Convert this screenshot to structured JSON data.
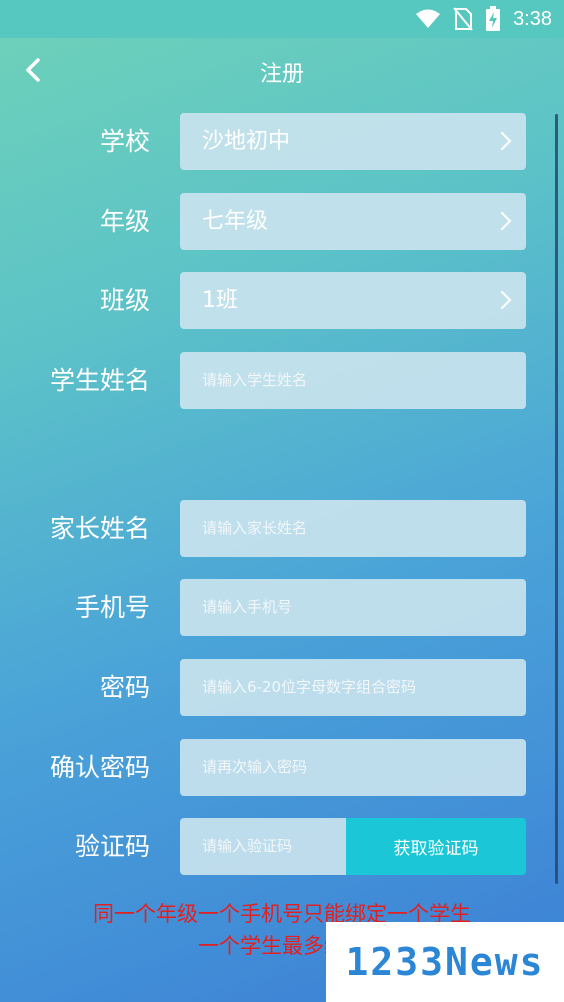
{
  "status_bar": {
    "time": "3:38"
  },
  "header": {
    "title": "注册"
  },
  "form": {
    "school": {
      "label": "学校",
      "value": "沙地初中"
    },
    "grade": {
      "label": "年级",
      "value": "七年级"
    },
    "class": {
      "label": "班级",
      "value": "1班"
    },
    "student_name": {
      "label": "学生姓名",
      "placeholder": "请输入学生姓名"
    },
    "parent_name": {
      "label": "家长姓名",
      "placeholder": "请输入家长姓名"
    },
    "phone": {
      "label": "手机号",
      "placeholder": "请输入手机号"
    },
    "password": {
      "label": "密码",
      "placeholder": "请输入6-20位字母数字组合密码"
    },
    "confirm_password": {
      "label": "确认密码",
      "placeholder": "请再次输入密码"
    },
    "verification_code": {
      "label": "验证码",
      "placeholder": "请输入验证码",
      "button": "获取验证码"
    }
  },
  "notice": {
    "line1": "同一个年级一个手机号只能绑定一个学生",
    "line2": "一个学生最多绑定"
  },
  "watermark": {
    "text": "1233News"
  },
  "colors": {
    "accent_button": "#1bc7d6",
    "notice_text": "#e3201f"
  }
}
